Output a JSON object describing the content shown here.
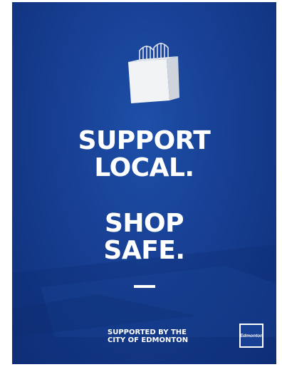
{
  "poster": {
    "headline_1": [
      "SUPPORT",
      "LOCAL."
    ],
    "headline_2": [
      "SHOP",
      "SAFE."
    ],
    "supporter_lines": [
      "SUPPORTED BY THE",
      "CITY OF EDMONTON"
    ],
    "logo_text": "Edmonton",
    "colors": {
      "background": "#173f93",
      "text": "#ffffff"
    },
    "icons": [
      "shopping-bag-icon"
    ]
  }
}
